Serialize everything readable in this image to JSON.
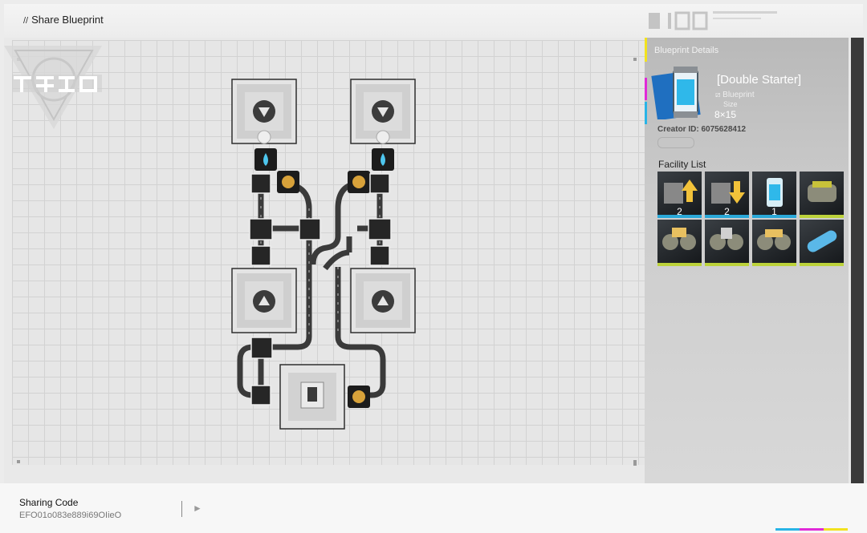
{
  "header": {
    "title": "Share Blueprint",
    "prefix": "//"
  },
  "panel": {
    "heading": "Blueprint Details",
    "name": "Double Starter",
    "type": "Blueprint",
    "size_label": "Size",
    "size": "8×15",
    "creator": "Creator ID: 6075628412",
    "facility_heading": "Facility List",
    "facilities": [
      {
        "icon": "conveyor-up-icon",
        "count": "2",
        "color": "#2aa8d8"
      },
      {
        "icon": "conveyor-down-icon",
        "count": "2",
        "color": "#2aa8d8"
      },
      {
        "icon": "canister-icon",
        "count": "1",
        "color": "#2aa8d8"
      },
      {
        "icon": "junction-box-icon",
        "count": "",
        "color": "#bcd23a"
      },
      {
        "icon": "splitter-icon",
        "count": "",
        "color": "#bcd23a"
      },
      {
        "icon": "merger-icon",
        "count": "",
        "color": "#bcd23a"
      },
      {
        "icon": "bridge-icon",
        "count": "",
        "color": "#bcd23a"
      },
      {
        "icon": "pipe-icon",
        "count": "",
        "color": "#bcd23a"
      }
    ]
  },
  "footer": {
    "label": "Sharing Code",
    "code": "EFO01o083e889i69OIieO"
  },
  "accents": {
    "yellow": "#f2e21e",
    "magenta": "#e02ad8",
    "cyan": "#28b4e6"
  }
}
